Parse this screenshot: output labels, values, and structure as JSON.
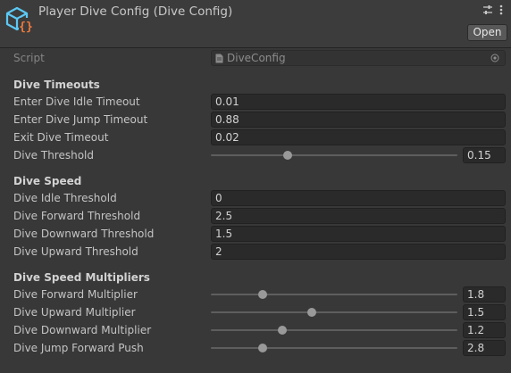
{
  "header": {
    "title": "Player Dive Config (Dive Config)",
    "open_label": "Open"
  },
  "script_field": {
    "label": "Script",
    "value": "DiveConfig"
  },
  "sections": {
    "timeouts": {
      "title": "Dive Timeouts",
      "enter_idle": {
        "label": "Enter Dive Idle Timeout",
        "value": "0.01"
      },
      "enter_jump": {
        "label": "Enter Dive Jump Timeout",
        "value": "0.88"
      },
      "exit": {
        "label": "Exit Dive Timeout",
        "value": "0.02"
      },
      "threshold": {
        "label": "Dive Threshold",
        "value": "0.15",
        "fraction": 0.31
      }
    },
    "speed": {
      "title": "Dive Speed",
      "idle": {
        "label": "Dive Idle Threshold",
        "value": "0"
      },
      "forward": {
        "label": "Dive Forward Threshold",
        "value": "2.5"
      },
      "downward": {
        "label": "Dive Downward Threshold",
        "value": "1.5"
      },
      "upward": {
        "label": "Dive Upward Threshold",
        "value": "2"
      }
    },
    "multipliers": {
      "title": "Dive Speed Multipliers",
      "forward": {
        "label": "Dive Forward Multiplier",
        "value": "1.8",
        "fraction": 0.21
      },
      "upward": {
        "label": "Dive Upward Multiplier",
        "value": "1.5",
        "fraction": 0.41
      },
      "downward": {
        "label": "Dive Downward Multiplier",
        "value": "1.2",
        "fraction": 0.29
      },
      "jump_push": {
        "label": "Dive Jump Forward Push",
        "value": "2.8",
        "fraction": 0.21
      }
    }
  },
  "icons": {
    "asset": "scriptable-object-icon",
    "settings": "sliders-settings-icon",
    "menu": "kebab-menu-icon",
    "script_file": "script-file-icon",
    "object_picker": "object-picker-icon"
  },
  "colors": {
    "asset_icon_blue": "#5cc8f4",
    "asset_icon_orange": "#f07a3c"
  }
}
